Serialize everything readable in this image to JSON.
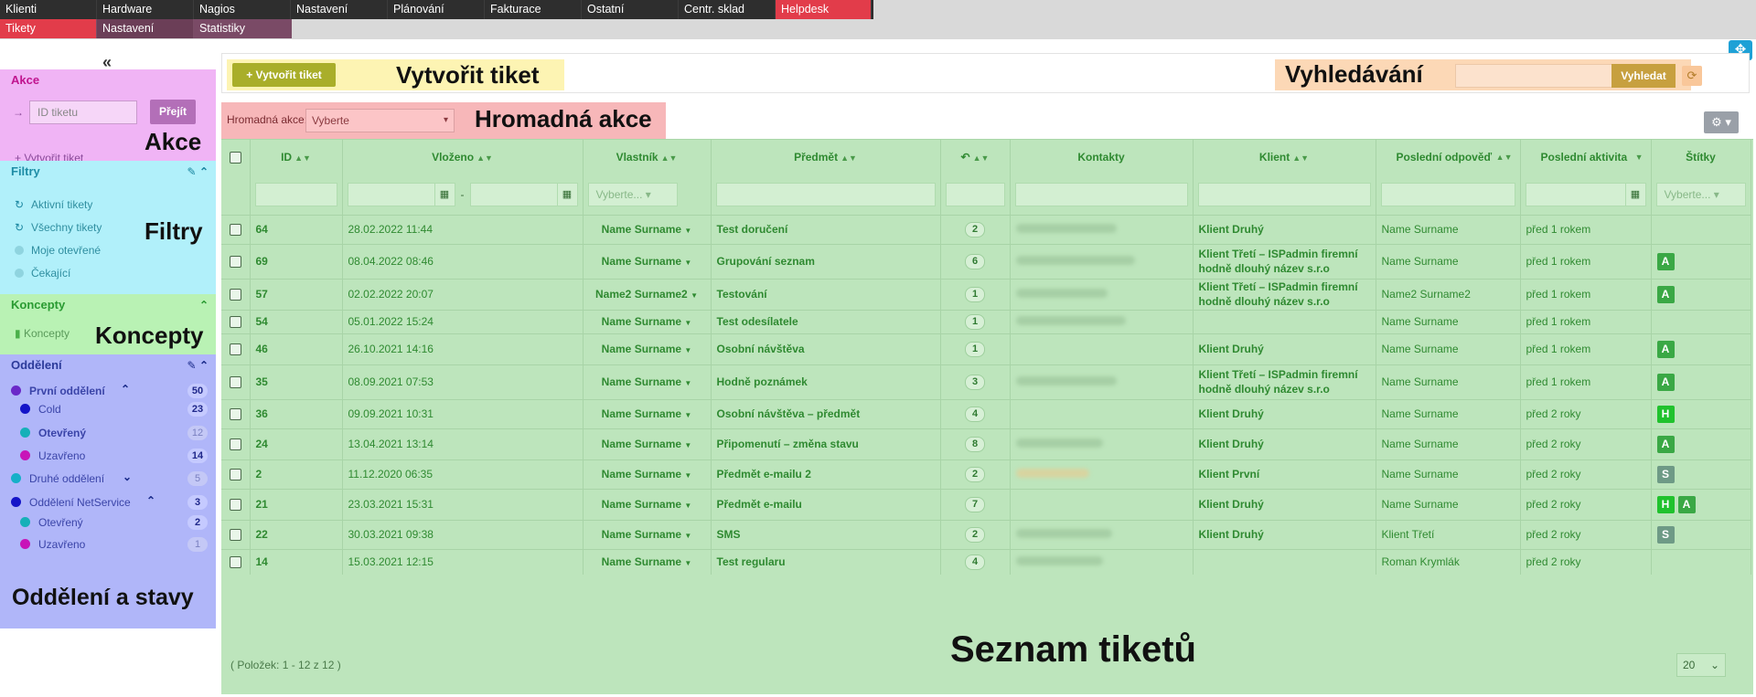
{
  "topnav": {
    "row1": [
      "Klienti",
      "Hardware",
      "Nagios",
      "Nastavení",
      "Plánování",
      "Fakturace",
      "Ostatní",
      "Centr. sklad",
      "Helpdesk"
    ],
    "row2": [
      "Tikety",
      "Nastavení",
      "Statistiky"
    ]
  },
  "sidebar": {
    "collapse": "«",
    "akce": {
      "title": "Akce",
      "ticket_placeholder": "ID tiketu",
      "go_label": "Přejít",
      "create_label": "Vytvořit tiket",
      "zone_label": "Akce"
    },
    "filtry": {
      "title": "Filtry",
      "zone_label": "Filtry",
      "items": [
        "Aktivní tikety",
        "Všechny tikety",
        "Moje otevřené",
        "Čekající"
      ]
    },
    "koncepty": {
      "title": "Koncepty",
      "item": "Koncepty",
      "zone_label": "Koncepty"
    },
    "oddeleni": {
      "title": "Oddělení",
      "zone_label": "Oddělení a stavy",
      "depts": [
        {
          "label": "První oddělení",
          "count": "50",
          "color": "#6a28c8"
        },
        {
          "label": "Cold",
          "count": "23",
          "color": "#1414c8"
        },
        {
          "label": "Otevřený",
          "count": "12",
          "color": "#16b0b8"
        },
        {
          "label": "Uzavřeno",
          "count": "14",
          "color": "#c814b8"
        },
        {
          "label": "Druhé oddělení",
          "count": "5",
          "color": "#16b0c8"
        },
        {
          "label": "Oddělení NetService",
          "count": "3",
          "color": "#1414c8"
        },
        {
          "label": "Otevřený",
          "count": "2",
          "color": "#16b0b8"
        },
        {
          "label": "Uzavřeno",
          "count": "1",
          "color": "#c814b8"
        }
      ]
    }
  },
  "toolbar": {
    "create_button": "+ Vytvořit tiket",
    "create_zone_label": "Vytvořit tiket",
    "search_zone_label": "Vyhledávání",
    "search_button": "Vyhledat",
    "refresh_icon": "refresh-icon"
  },
  "bulk": {
    "label": "Hromadná akce:",
    "selected": "Vyberte",
    "zone_label": "Hromadná akce"
  },
  "table": {
    "headers": {
      "id": "ID",
      "inserted": "Vloženo",
      "owner": "Vlastník",
      "subject": "Předmět",
      "replies": "↶",
      "contacts": "Kontakty",
      "client": "Klient",
      "last_reply": "Poslední odpověď",
      "last_activity": "Poslední aktivita",
      "tags": "Štítky"
    },
    "filter_select_placeholder": "Vyberte...",
    "rows": [
      {
        "id": "64",
        "date": "28.02.2022 11:44",
        "owner": "Name Surname",
        "subject": "Test doručení",
        "n": "2",
        "client": "Klient Druhý",
        "last_reply": "Name Surname",
        "activity": "před 1 rokem",
        "tags": ""
      },
      {
        "id": "69",
        "date": "08.04.2022 08:46",
        "owner": "Name Surname",
        "subject": "Grupování seznam",
        "n": "6",
        "client": "Klient Třetí – ISPadmin firemní hodně dlouhý název s.r.o",
        "last_reply": "Name Surname",
        "activity": "před 1 rokem",
        "tags": "A"
      },
      {
        "id": "57",
        "date": "02.02.2022 20:07",
        "owner": "Name2 Surname2",
        "subject": "Testování",
        "n": "1",
        "client": "Klient Třetí – ISPadmin firemní hodně dlouhý název s.r.o",
        "last_reply": "Name2 Surname2",
        "activity": "před 1 rokem",
        "tags": "A"
      },
      {
        "id": "54",
        "date": "05.01.2022 15:24",
        "owner": "Name Surname",
        "subject": "Test odesílatele",
        "n": "1",
        "client": "",
        "last_reply": "Name Surname",
        "activity": "před 1 rokem",
        "tags": ""
      },
      {
        "id": "46",
        "date": "26.10.2021 14:16",
        "owner": "Name Surname",
        "subject": "Osobní návštěva",
        "n": "1",
        "client": "Klient Druhý",
        "last_reply": "Name Surname",
        "activity": "před 1 rokem",
        "tags": "A"
      },
      {
        "id": "35",
        "date": "08.09.2021 07:53",
        "owner": "Name Surname",
        "subject": "Hodně poznámek",
        "n": "3",
        "client": "Klient Třetí – ISPadmin firemní hodně dlouhý název s.r.o",
        "last_reply": "Name Surname",
        "activity": "před 1 rokem",
        "tags": "A"
      },
      {
        "id": "36",
        "date": "09.09.2021 10:31",
        "owner": "Name Surname",
        "subject": "Osobní návštěva – předmět",
        "n": "4",
        "client": "Klient Druhý",
        "last_reply": "Name Surname",
        "activity": "před 2 roky",
        "tags": "H"
      },
      {
        "id": "24",
        "date": "13.04.2021 13:14",
        "owner": "Name Surname",
        "subject": "Připomenutí – změna stavu",
        "n": "8",
        "client": "Klient Druhý",
        "last_reply": "Name Surname",
        "activity": "před 2 roky",
        "tags": "A"
      },
      {
        "id": "2",
        "date": "11.12.2020 06:35",
        "owner": "Name Surname",
        "subject": "Předmět e-mailu 2",
        "n": "2",
        "client": "Klient První",
        "last_reply": "Name Surname",
        "activity": "před 2 roky",
        "tags": "S"
      },
      {
        "id": "21",
        "date": "23.03.2021 15:31",
        "owner": "Name Surname",
        "subject": "Předmět e-mailu",
        "n": "7",
        "client": "Klient Druhý",
        "last_reply": "Name Surname",
        "activity": "před 2 roky",
        "tags": "HA"
      },
      {
        "id": "22",
        "date": "30.03.2021 09:38",
        "owner": "Name Surname",
        "subject": "SMS",
        "n": "2",
        "client": "Klient Druhý",
        "last_reply": "Klient Třetí",
        "activity": "před 2 roky",
        "tags": "S"
      },
      {
        "id": "14",
        "date": "15.03.2021 12:15",
        "owner": "Name Surname",
        "subject": "Test regularu",
        "n": "4",
        "client": "",
        "last_reply": "Roman Krymlák",
        "activity": "před 2 roky",
        "tags": ""
      }
    ],
    "pager": "( Položek: 1 - 12 z 12 )",
    "per_page": "20",
    "zone_label": "Seznam tiketů"
  }
}
